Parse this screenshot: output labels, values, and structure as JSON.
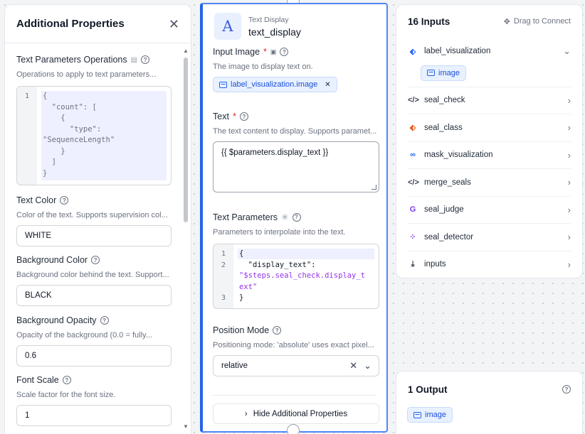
{
  "left_panel": {
    "title": "Additional Properties",
    "fields": {
      "text_params_ops": {
        "label": "Text Parameters Operations",
        "description": "Operations to apply to text parameters...",
        "code_lines": [
          {
            "n": "1",
            "t": "{"
          },
          {
            "n": "",
            "t": "  \"count\": ["
          },
          {
            "n": "",
            "t": "    {"
          },
          {
            "n": "",
            "t": "      \"type\":"
          },
          {
            "n": "",
            "t": "\"SequenceLength\""
          },
          {
            "n": "",
            "t": "    }"
          },
          {
            "n": "",
            "t": "  ]"
          },
          {
            "n": "",
            "t": "}"
          }
        ]
      },
      "text_color": {
        "label": "Text Color",
        "description": "Color of the text. Supports supervision col...",
        "value": "WHITE"
      },
      "background_color": {
        "label": "Background Color",
        "description": "Background color behind the text. Support...",
        "value": "BLACK"
      },
      "background_opacity": {
        "label": "Background Opacity",
        "description": "Opacity of the background (0.0 = fully...",
        "value": "0.6"
      },
      "font_scale": {
        "label": "Font Scale",
        "description": "Scale factor for the font size.",
        "value": "1"
      }
    }
  },
  "node": {
    "type": "Text Display",
    "name": "text_display",
    "icon_glyph": "A",
    "input_image": {
      "label": "Input Image",
      "description": "The image to display text on.",
      "chip": "label_visualization.image"
    },
    "text": {
      "label": "Text",
      "description": "The text content to display. Supports paramet...",
      "value": "{{ $parameters.display_text }}"
    },
    "text_parameters": {
      "label": "Text Parameters",
      "description": "Parameters to interpolate into the text.",
      "code_lines": [
        {
          "n": "1",
          "t": "{"
        },
        {
          "n": "2",
          "t": "  \"display_text\":"
        },
        {
          "n": "",
          "t": "\"$steps.seal_check.display_t"
        },
        {
          "n": "",
          "t": "ext\""
        },
        {
          "n": "3",
          "t": "}"
        }
      ]
    },
    "position_mode": {
      "label": "Position Mode",
      "description": "Positioning mode: 'absolute' uses exact pixel...",
      "value": "relative"
    },
    "hide_button": "Hide Additional Properties"
  },
  "inputs_panel": {
    "title": "16 Inputs",
    "drag_label": "Drag to Connect",
    "expanded_chip": "image",
    "items": [
      {
        "label": "label_visualization",
        "icon": "tag-icon",
        "glyph": "⬖",
        "color": "#2563eb",
        "expanded": true
      },
      {
        "label": "seal_check",
        "icon": "code-icon",
        "glyph": "</>",
        "color": "#374151"
      },
      {
        "label": "seal_class",
        "icon": "tag-icon",
        "glyph": "⬖",
        "color": "#ea580c"
      },
      {
        "label": "mask_visualization",
        "icon": "mask-icon",
        "glyph": "∞",
        "color": "#2563eb"
      },
      {
        "label": "merge_seals",
        "icon": "code-icon",
        "glyph": "</>",
        "color": "#374151"
      },
      {
        "label": "seal_judge",
        "icon": "google-icon",
        "glyph": "G",
        "color": "#7c3aed"
      },
      {
        "label": "seal_detector",
        "icon": "graph-icon",
        "glyph": "⁘",
        "color": "#7c3aed"
      },
      {
        "label": "inputs",
        "icon": "download-icon",
        "glyph": "⤓",
        "color": "#374151"
      }
    ]
  },
  "outputs_panel": {
    "title": "1 Output",
    "chip": "image"
  },
  "colors": {
    "accent": "#2563eb",
    "required": "#dc2626"
  }
}
